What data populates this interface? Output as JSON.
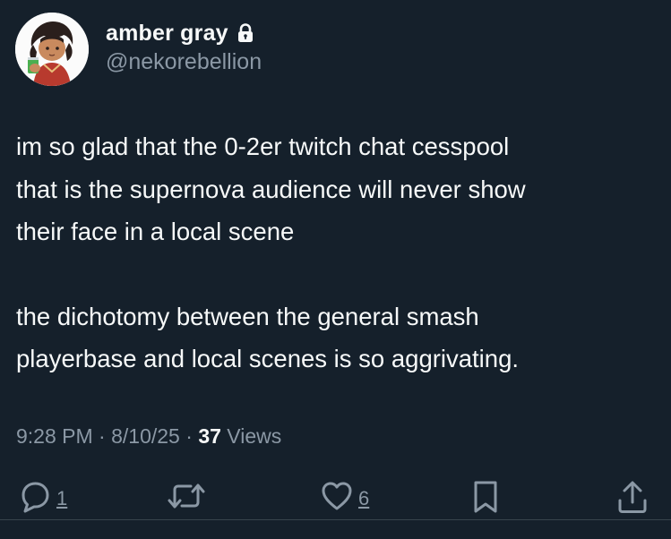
{
  "user": {
    "display_name": "amber gray",
    "handle": "@nekorebellion",
    "protected": true
  },
  "tweet": {
    "paragraphs": [
      [
        "im so glad that the 0-2er twitch chat cesspool",
        "that is the supernova audience will never show",
        "their face in a local scene"
      ],
      [
        "the dichotomy between the general smash",
        "playerbase and local scenes is so aggrivating."
      ]
    ]
  },
  "meta": {
    "time": "9:28 PM",
    "sep1": " · ",
    "date": "8/10/25",
    "sep2": " · ",
    "views_count": "37",
    "views_label": " Views"
  },
  "actions": {
    "reply_count": "1",
    "like_count": "6"
  },
  "icons": {
    "lock": "lock-icon",
    "reply": "speech-bubble-icon",
    "retweet": "retweet-arrows-icon",
    "like": "heart-icon",
    "bookmark": "bookmark-icon",
    "share": "share-upload-icon"
  },
  "colors": {
    "background": "#15202b",
    "primary_text": "#f7f9f9",
    "secondary_text": "#8b98a5"
  }
}
